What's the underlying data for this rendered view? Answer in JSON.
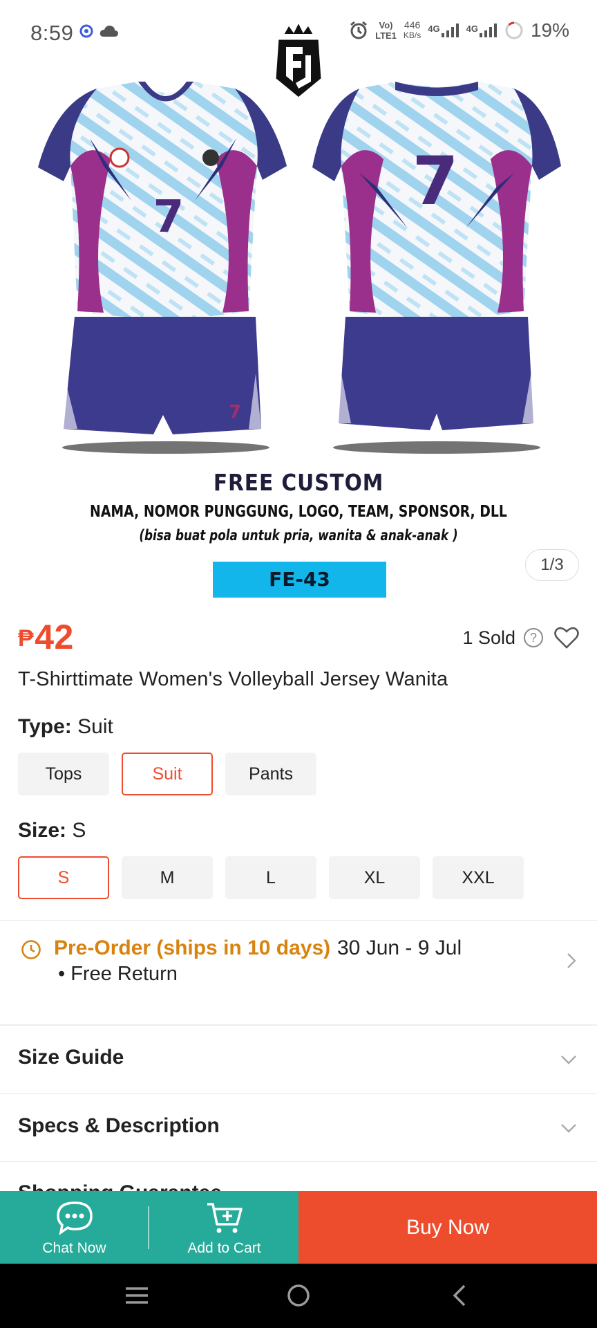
{
  "status_bar": {
    "time": "8:59",
    "network_speed": "446",
    "network_unit": "KB/s",
    "volte_label": "Vo)",
    "lte_label": "LTE1",
    "net1": "4G",
    "net2": "4G",
    "battery": "19%",
    "icons": [
      "notification-icon",
      "cloud-icon",
      "alarm-icon",
      "signal-icon",
      "battery-icon"
    ]
  },
  "gallery": {
    "promo_title": "FREE CUSTOM",
    "promo_subtitle": "NAMA, NOMOR PUNGGUNG, LOGO, TEAM, SPONSOR, DLL",
    "promo_note": "(bisa buat pola untuk pria, wanita & anak-anak )",
    "product_code": "FE-43",
    "jersey_number": "7",
    "page_indicator": "1/3"
  },
  "product": {
    "currency": "₱",
    "price": "42",
    "sold": "1 Sold",
    "title": "T-Shirttimate Women's Volleyball Jersey Wanita"
  },
  "options": {
    "type_label": "Type:",
    "type_value": "Suit",
    "types": [
      "Tops",
      "Suit",
      "Pants"
    ],
    "size_label": "Size:",
    "size_value": "S",
    "sizes": [
      "S",
      "M",
      "L",
      "XL",
      "XXL"
    ]
  },
  "shipping": {
    "preorder": "Pre-Order (ships in 10 days)",
    "dates": "30 Jun - 9 Jul",
    "free_return": "• Free Return"
  },
  "sections": {
    "size_guide": "Size Guide",
    "specs": "Specs & Description",
    "shopping_guarantee": "Shopping Guarantee"
  },
  "actions": {
    "chat": "Chat Now",
    "cart": "Add to Cart",
    "buy": "Buy Now"
  },
  "colors": {
    "accent": "#ee4d2d",
    "green": "#26aa99",
    "preorder": "#d9830f",
    "code_tag": "#12b6ea"
  }
}
